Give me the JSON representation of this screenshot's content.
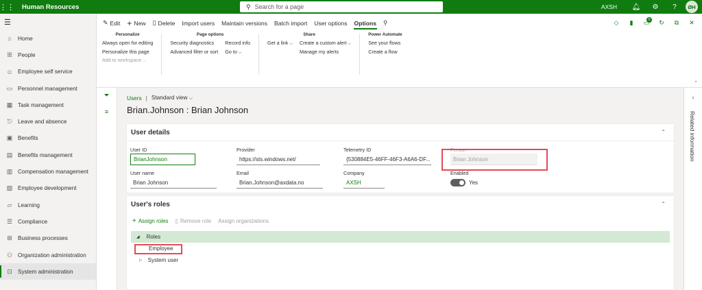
{
  "topbar": {
    "app_title": "Human Resources",
    "search_placeholder": "Search for a page",
    "company": "AXSH",
    "user_initials": "ØH"
  },
  "nav": {
    "items": [
      {
        "label": "Home",
        "icon": "⌂"
      },
      {
        "label": "People",
        "icon": "ꕥ"
      },
      {
        "label": "Employee self service",
        "icon": "☺"
      },
      {
        "label": "Personnel management",
        "icon": "▭"
      },
      {
        "label": "Task management",
        "icon": "▦"
      },
      {
        "label": "Leave and absence",
        "icon": "⎋"
      },
      {
        "label": "Benefits",
        "icon": "▣"
      },
      {
        "label": "Benefits management",
        "icon": "▤"
      },
      {
        "label": "Compensation management",
        "icon": "▥"
      },
      {
        "label": "Employee development",
        "icon": "▧"
      },
      {
        "label": "Learning",
        "icon": "▱"
      },
      {
        "label": "Compliance",
        "icon": "☰"
      },
      {
        "label": "Business processes",
        "icon": "⊞"
      },
      {
        "label": "Organization administration",
        "icon": "⚇"
      },
      {
        "label": "System administration",
        "icon": "⊡"
      }
    ]
  },
  "actionpane": {
    "tabs": [
      {
        "label": "Edit",
        "icon": "✎"
      },
      {
        "label": "New",
        "icon": "+"
      },
      {
        "label": "Delete",
        "icon": "🗑"
      },
      {
        "label": "Import users",
        "icon": ""
      },
      {
        "label": "Maintain versions",
        "icon": ""
      },
      {
        "label": "Batch import",
        "icon": ""
      },
      {
        "label": "User options",
        "icon": ""
      },
      {
        "label": "Options",
        "icon": ""
      }
    ],
    "groups": {
      "personalize": {
        "title": "Personalize",
        "items": [
          "Always open for editing",
          "Personalize this page",
          "Add to workspace"
        ]
      },
      "page_options": {
        "title": "Page options",
        "col1": [
          "Security diagnostics",
          "Advanced filter or sort"
        ],
        "col2": [
          "Record info",
          "Go to"
        ]
      },
      "share": {
        "title": "Share",
        "col1": [
          "Get a link"
        ],
        "col2": [
          "Create a custom alert",
          "Manage my alerts"
        ]
      },
      "power_automate": {
        "title": "Power Automate",
        "items": [
          "See your flows",
          "Create a flow"
        ]
      }
    },
    "notification_count": "0"
  },
  "breadcrumb": {
    "link": "Users",
    "view": "Standard view"
  },
  "page_title": "Brian.Johnson : Brian Johnson",
  "user_details": {
    "title": "User details",
    "fields": {
      "user_id": {
        "label": "User ID",
        "value": "BrianJohnson"
      },
      "provider": {
        "label": "Provider",
        "value": "https://sts.windows.net/"
      },
      "telemetry_id": {
        "label": "Telemetry ID",
        "value": "{530884E5-46FF-46F3-A6A6-DF..."
      },
      "person": {
        "label": "Person",
        "value": "Brian Johnson"
      },
      "user_name": {
        "label": "User name",
        "value": "Brian Johnson"
      },
      "email": {
        "label": "Email",
        "value": "Brian.Johnson@axdata.no"
      },
      "company": {
        "label": "Company",
        "value": "AXSH"
      },
      "enabled": {
        "label": "Enabled",
        "value": "Yes"
      }
    }
  },
  "user_roles": {
    "title": "User's roles",
    "toolbar": {
      "assign_roles": "Assign roles",
      "remove_role": "Remove role",
      "assign_orgs": "Assign organizations"
    },
    "tree": {
      "root": "Roles",
      "children": [
        "Employee",
        "System user"
      ]
    }
  },
  "right_panel": {
    "title": "Related information"
  },
  "colors": {
    "brand": "#107c10",
    "highlight": "#e74856"
  }
}
